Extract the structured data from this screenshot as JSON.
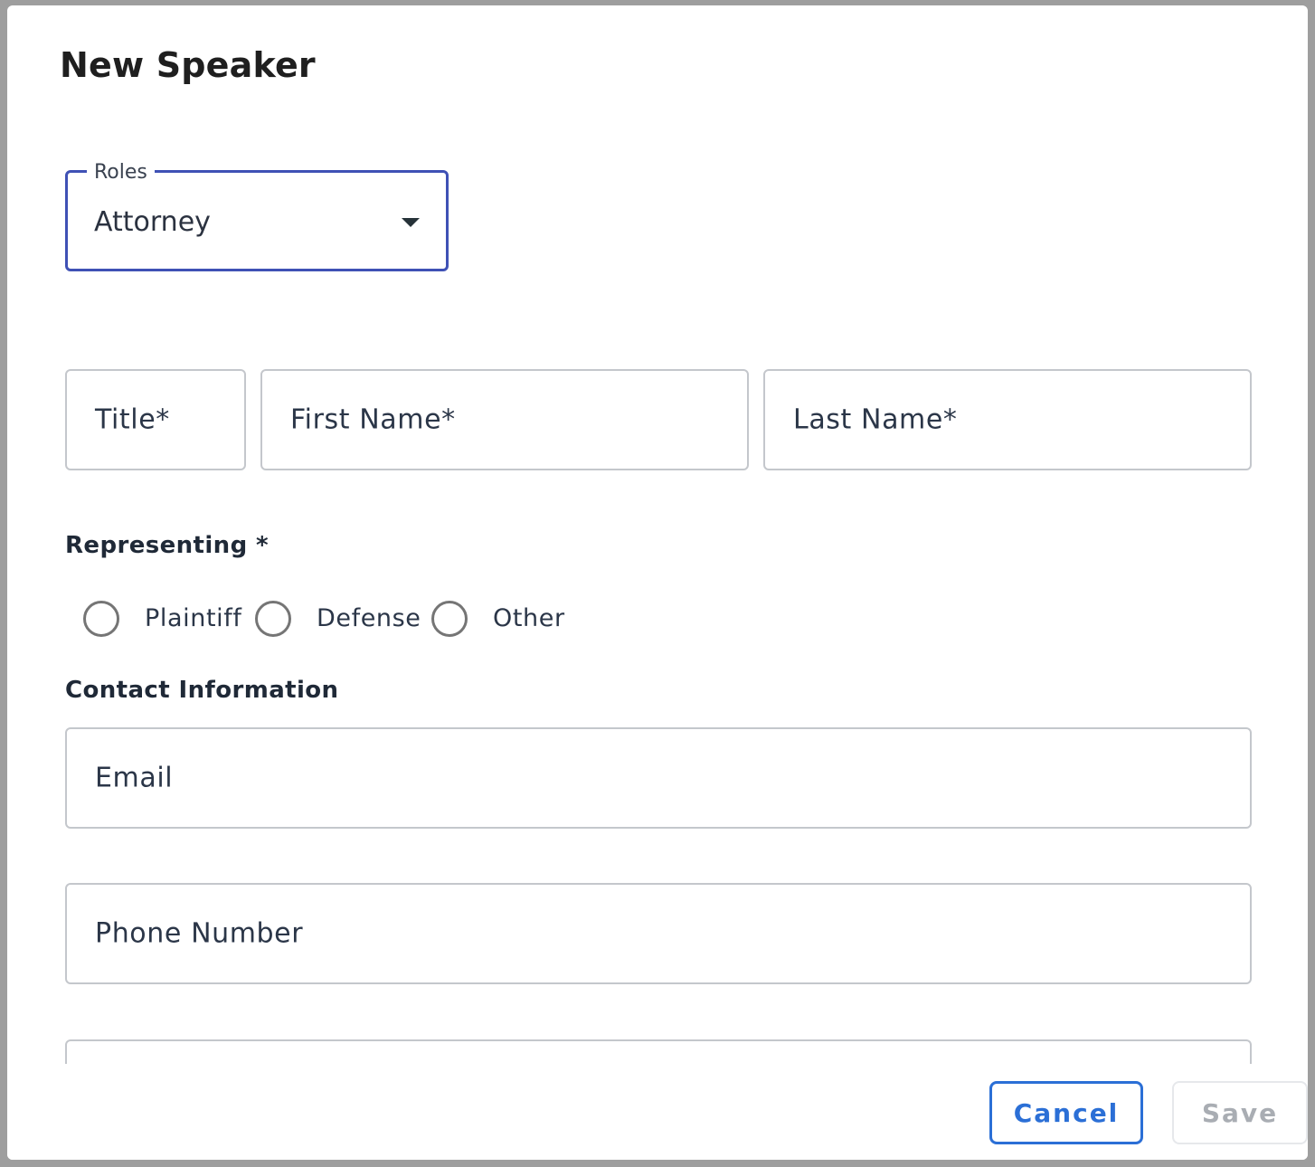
{
  "dialog": {
    "title": "New Speaker"
  },
  "roles": {
    "label": "Roles",
    "value": "Attorney"
  },
  "name_fields": {
    "title_placeholder": "Title*",
    "first_name_placeholder": "First Name*",
    "last_name_placeholder": "Last Name*"
  },
  "representing": {
    "label": "Representing *",
    "options": [
      {
        "label": "Plaintiff",
        "selected": false
      },
      {
        "label": "Defense",
        "selected": false
      },
      {
        "label": "Other",
        "selected": false
      }
    ]
  },
  "contact": {
    "label": "Contact Information",
    "email_placeholder": "Email",
    "phone_placeholder": "Phone Number"
  },
  "actions": {
    "cancel_label": "Cancel",
    "save_label": "Save"
  },
  "colors": {
    "accent": "#3f51b5",
    "primary_button": "#2b6fd6",
    "disabled_text": "#a9adb3"
  },
  "icons": {
    "roles_dropdown": "caret-down-icon"
  }
}
